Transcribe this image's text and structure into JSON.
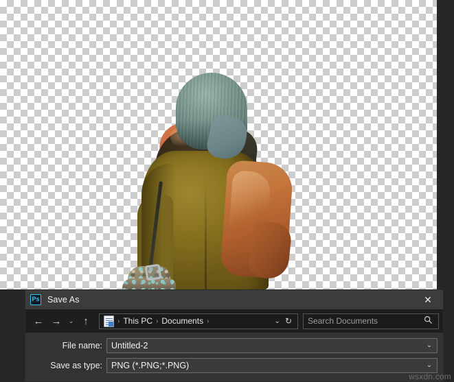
{
  "app": {
    "canvas_background": "transparency-checkerboard",
    "checker_light": "#ffffff",
    "checker_dark": "#cdcdcd"
  },
  "artwork": {
    "description": "Cut-out photo of a person seen from behind wearing a teal knit beanie, an olive-green coat and a rust-orange scarf, with a patterned bag on a shoulder strap",
    "colors": {
      "beanie": "#7f9a93",
      "coat": "#8a7420",
      "scarf": "#c4763c",
      "hood": "#33281a",
      "bag": "#8f8568"
    }
  },
  "dialog": {
    "app_icon": "photoshop-icon",
    "app_icon_text": "Ps",
    "app_icon_color": "#31c5f0",
    "title": "Save As",
    "close_label": "✕",
    "nav": {
      "back_icon": "←",
      "forward_icon": "→",
      "history_icon": "⌄",
      "up_icon": "↑"
    },
    "address": {
      "folder_icon": "documents-folder-icon",
      "crumbs": [
        "This PC",
        "Documents"
      ],
      "separator": "›",
      "dropdown_icon": "⌄",
      "refresh_icon": "↻"
    },
    "search": {
      "placeholder": "Search Documents",
      "value": "",
      "icon": "🔍"
    },
    "fields": [
      {
        "label": "File name:",
        "value": "Untitled-2",
        "chevron": "⌄"
      },
      {
        "label": "Save as type:",
        "value": "PNG (*.PNG;*.PNG)",
        "chevron": "⌄"
      }
    ]
  },
  "watermark": "wsxdn.com"
}
